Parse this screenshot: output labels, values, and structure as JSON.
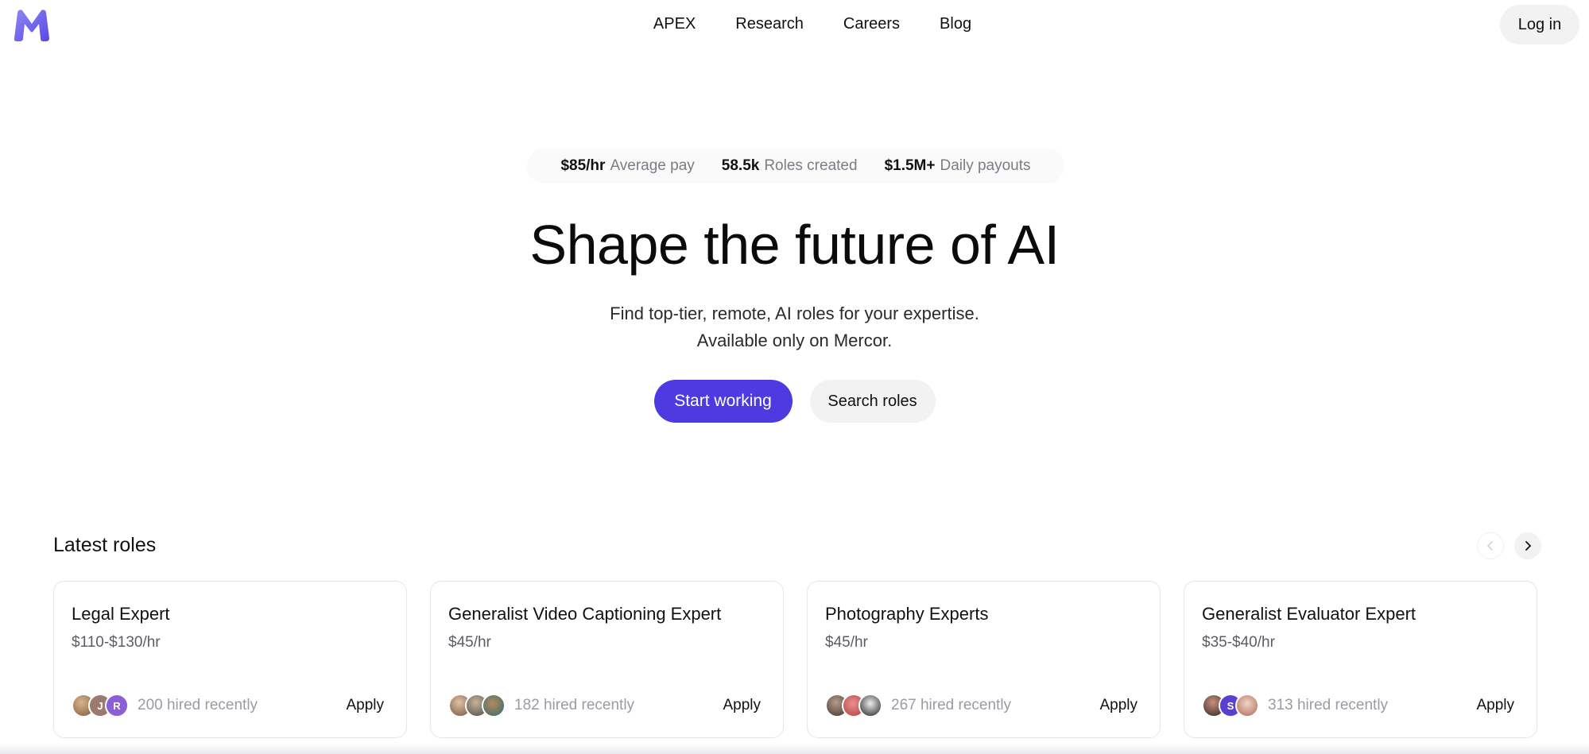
{
  "header": {
    "logo_label": "M",
    "nav": [
      "APEX",
      "Research",
      "Careers",
      "Blog"
    ],
    "login_label": "Log in"
  },
  "stats": [
    {
      "value": "$85/hr",
      "label": "Average pay"
    },
    {
      "value": "58.5k",
      "label": "Roles created"
    },
    {
      "value": "$1.5M+",
      "label": "Daily payouts"
    }
  ],
  "hero": {
    "title": "Shape the future of AI",
    "subtitle_line1": "Find top-tier, remote, AI roles for your expertise.",
    "subtitle_line2": "Available only on Mercor.",
    "primary_cta": "Start working",
    "secondary_cta": "Search roles"
  },
  "roles": {
    "title": "Latest roles",
    "prev_icon": "chevron-left-icon",
    "next_icon": "chevron-right-icon",
    "cards": [
      {
        "title": "Legal Expert",
        "pay": "$110-$130/hr",
        "hired": "200 hired recently",
        "apply": "Apply",
        "avatar_letters": [
          "",
          "J",
          "R"
        ]
      },
      {
        "title": "Generalist Video Captioning Expert",
        "pay": "$45/hr",
        "hired": "182 hired recently",
        "apply": "Apply",
        "avatar_letters": [
          "",
          "",
          ""
        ]
      },
      {
        "title": "Photography Experts",
        "pay": "$45/hr",
        "hired": "267 hired recently",
        "apply": "Apply",
        "avatar_letters": [
          "",
          "",
          ""
        ]
      },
      {
        "title": "Generalist Evaluator Expert",
        "pay": "$35-$40/hr",
        "hired": "313 hired recently",
        "apply": "Apply",
        "avatar_letters": [
          "",
          "S",
          ""
        ]
      }
    ]
  },
  "colors": {
    "brand_primary": "#4d3ae0",
    "logo": "#7b6cf0"
  }
}
